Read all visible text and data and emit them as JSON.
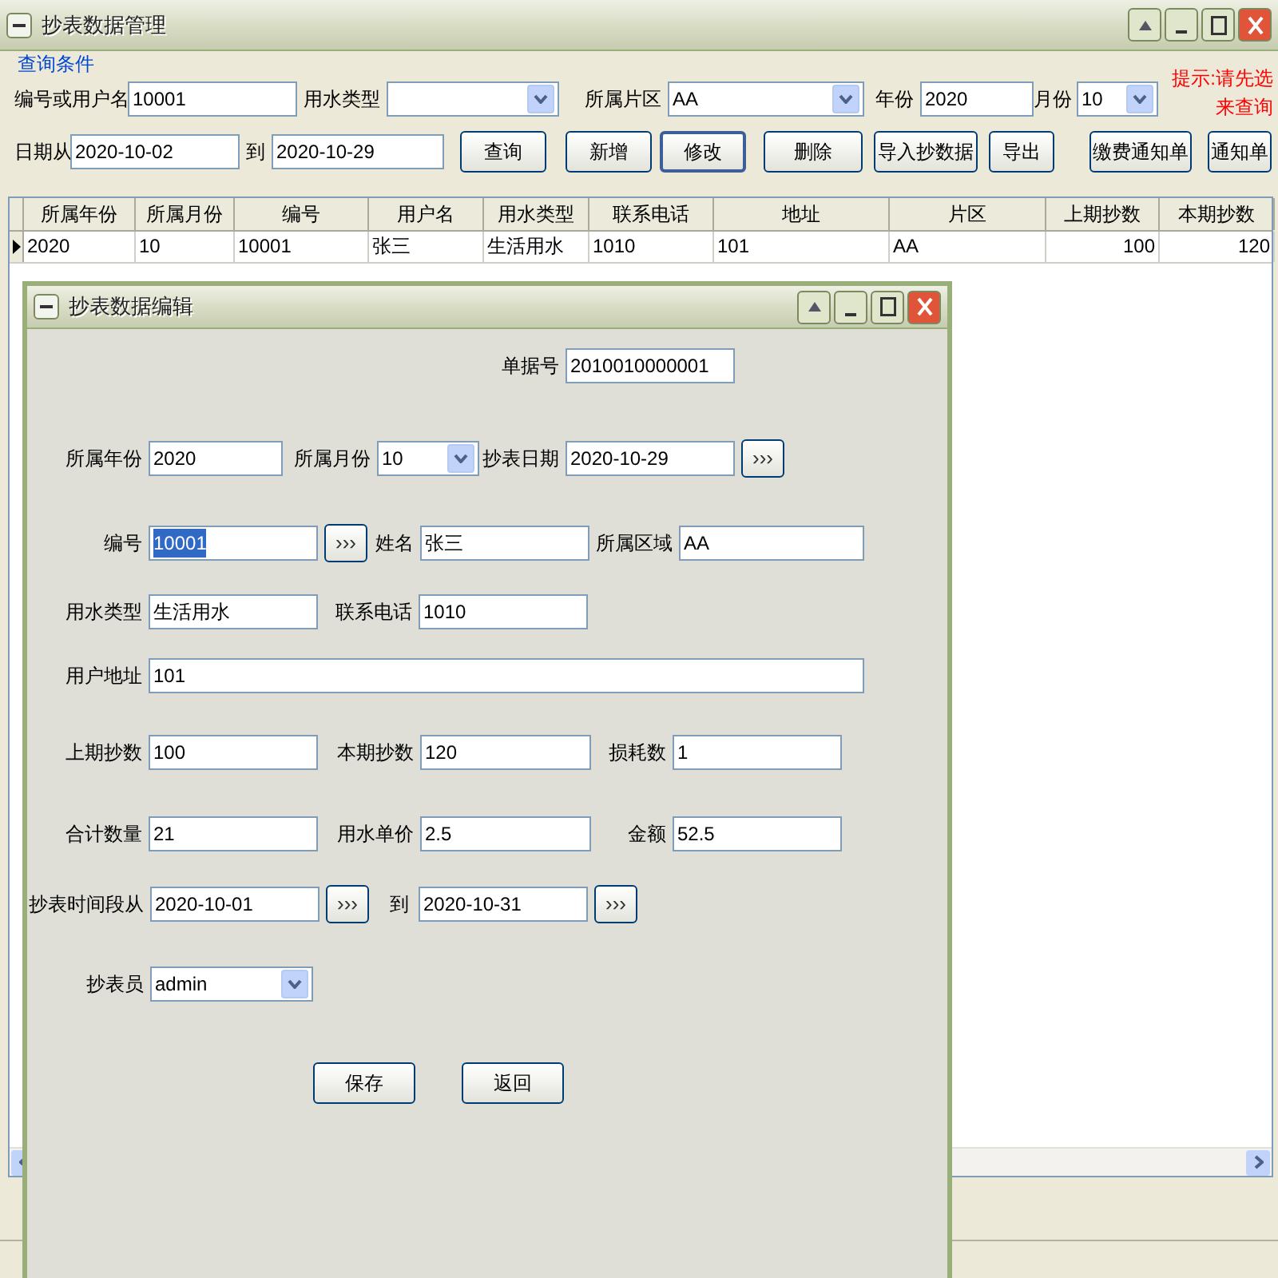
{
  "main_window": {
    "title": "抄表数据管理"
  },
  "query_group": {
    "title": "查询条件"
  },
  "filters": [
    {
      "label": "编号或用户名",
      "value": "10001",
      "kind": "text"
    },
    {
      "label": "用水类型",
      "kind": "select"
    },
    {
      "label": "所属片区",
      "value": "AA",
      "kind": "select"
    },
    {
      "label": "年份",
      "value": "2020",
      "kind": "text"
    },
    {
      "label": "月份",
      "value": "10",
      "kind": "select"
    }
  ],
  "hint": [
    "提示:请先选",
    "来查询"
  ],
  "date_filters": [
    {
      "label": "日期从",
      "value": "2020-10-02",
      "kind": "text"
    },
    {
      "label": "到",
      "value": "2020-10-29",
      "kind": "text"
    }
  ],
  "toolbar_buttons": [
    {
      "label": "查询",
      "focused": false
    },
    {
      "label": "新增",
      "focused": false
    },
    {
      "label": "修改",
      "focused": true
    },
    {
      "label": "删除",
      "focused": false
    },
    {
      "label": "导入抄数据",
      "focused": false
    },
    {
      "label": "导出",
      "focused": false
    },
    {
      "label": "缴费通知单",
      "focused": false
    },
    {
      "label": "通知单",
      "focused": false
    }
  ],
  "table": {
    "columns": [
      "所属年份",
      "所属月份",
      "编号",
      "用户名",
      "用水类型",
      "联系电话",
      "地址",
      "片区",
      "上期抄数",
      "本期抄数"
    ],
    "rows": [
      {
        "selected": true,
        "cells": [
          "2020",
          "10",
          "10001",
          "张三",
          "生活用水",
          "1010",
          "101",
          "AA",
          "100",
          "120"
        ]
      }
    ]
  },
  "dialog": {
    "title": "抄表数据编辑",
    "rows": [
      {
        "fields": [
          {
            "label": "单据号",
            "value": "2010010000001",
            "kind": "text",
            "text_selected": false
          }
        ]
      },
      {
        "fields": [
          {
            "label": "所属年份",
            "value": "2020",
            "kind": "text",
            "text_selected": false
          },
          {
            "label": "所属月份",
            "value": "10",
            "kind": "select",
            "text_selected": false
          },
          {
            "label": "抄表日期",
            "value": "2020-10-29",
            "kind": "picker",
            "picker": "›››",
            "text_selected": false
          }
        ]
      },
      {
        "fields": [
          {
            "label": "编号",
            "value": "10001",
            "kind": "picker",
            "picker": "›››",
            "text_selected": true
          },
          {
            "label": "姓名",
            "value": "张三",
            "kind": "text",
            "text_selected": false
          },
          {
            "label": "所属区域",
            "value": "AA",
            "kind": "text",
            "text_selected": false
          }
        ]
      },
      {
        "fields": [
          {
            "label": "用水类型",
            "value": "生活用水",
            "kind": "text",
            "text_selected": false
          },
          {
            "label": "联系电话",
            "value": "1010",
            "kind": "text",
            "text_selected": false
          }
        ]
      },
      {
        "fields": [
          {
            "label": "用户地址",
            "value": "101",
            "kind": "text",
            "text_selected": false
          }
        ]
      },
      {
        "fields": [
          {
            "label": "上期抄数",
            "value": "100",
            "kind": "text",
            "text_selected": false
          },
          {
            "label": "本期抄数",
            "value": "120",
            "kind": "text",
            "text_selected": false
          },
          {
            "label": "损耗数",
            "value": "1",
            "kind": "text",
            "text_selected": false
          }
        ]
      },
      {
        "fields": [
          {
            "label": "合计数量",
            "value": "21",
            "kind": "text",
            "text_selected": false
          },
          {
            "label": "用水单价",
            "value": "2.5",
            "kind": "text",
            "text_selected": false
          },
          {
            "label": "金额",
            "value": "52.5",
            "kind": "text",
            "text_selected": false
          }
        ]
      },
      {
        "fields": [
          {
            "label": "抄表时间段从",
            "value": "2020-10-01",
            "kind": "picker",
            "picker": "›››",
            "text_selected": false
          },
          {
            "label": "到",
            "value": "2020-10-31",
            "kind": "picker",
            "picker": "›››",
            "text_selected": false
          }
        ]
      },
      {
        "fields": [
          {
            "label": "抄表员",
            "value": "admin",
            "kind": "select",
            "text_selected": false
          }
        ]
      }
    ],
    "buttons": [
      "保存",
      "返回"
    ]
  }
}
